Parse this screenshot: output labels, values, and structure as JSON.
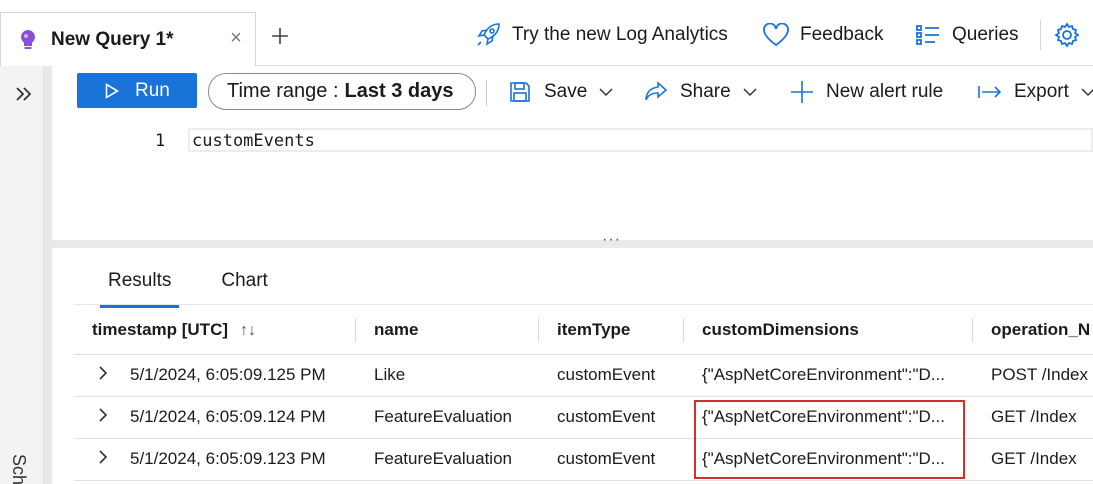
{
  "top": {
    "tab_title": "New Query 1*",
    "close_glyph": "×",
    "new_tab_glyph": "+",
    "try_label": "Try the new Log Analytics",
    "feedback_label": "Feedback",
    "queries_label": "Queries"
  },
  "rail": {
    "expand_glyph": "»",
    "side_label": "Sch"
  },
  "toolbar": {
    "run_label": "Run",
    "time_range_label": "Time range :",
    "time_range_value": "Last 3 days",
    "save_label": "Save",
    "share_label": "Share",
    "new_alert_label": "New alert rule",
    "export_label": "Export"
  },
  "editor": {
    "line_number": "1",
    "code": "customEvents"
  },
  "results": {
    "tabs": [
      "Results",
      "Chart"
    ],
    "columns": [
      "timestamp [UTC]",
      "name",
      "itemType",
      "customDimensions",
      "operation_N"
    ],
    "sort_glyph": "↑↓",
    "rows": [
      {
        "timestamp": "5/1/2024, 6:05:09.125 PM",
        "name": "Like",
        "itemType": "customEvent",
        "customDimensions": "{\"AspNetCoreEnvironment\":\"D...",
        "operation": "POST /Index"
      },
      {
        "timestamp": "5/1/2024, 6:05:09.124 PM",
        "name": "FeatureEvaluation",
        "itemType": "customEvent",
        "customDimensions": "{\"AspNetCoreEnvironment\":\"D...",
        "operation": "GET /Index"
      },
      {
        "timestamp": "5/1/2024, 6:05:09.123 PM",
        "name": "FeatureEvaluation",
        "itemType": "customEvent",
        "customDimensions": "{\"AspNetCoreEnvironment\":\"D...",
        "operation": "GET /Index"
      }
    ]
  },
  "colors": {
    "accent": "#1a73d8",
    "highlight": "#d32f2f",
    "bulb": "#8a4fd3"
  },
  "icons": [
    "lightbulb-icon",
    "close-icon",
    "plus-icon",
    "rocket-icon",
    "heart-icon",
    "list-icon",
    "gear-icon",
    "expand-icon",
    "play-icon",
    "save-icon",
    "share-icon",
    "chevron-down-icon",
    "export-icon",
    "row-expand-icon"
  ]
}
